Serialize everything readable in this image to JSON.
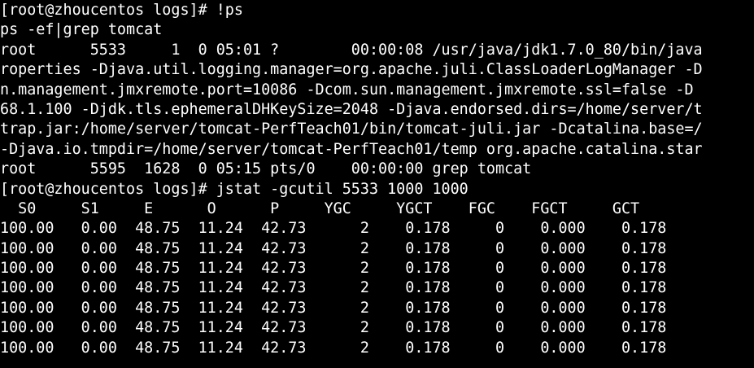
{
  "terminal": {
    "background": "#000000",
    "foreground": "#ffffff",
    "lines": [
      "[root@zhoucentos logs]# !ps",
      "ps -ef|grep tomcat",
      "root      5533     1  0 05:01 ?        00:00:08 /usr/java/jdk1.7.0_80/bin/java",
      "roperties -Djava.util.logging.manager=org.apache.juli.ClassLoaderLogManager -D",
      "n.management.jmxremote.port=10086 -Dcom.sun.management.jmxremote.ssl=false -D",
      "68.1.100 -Djdk.tls.ephemeralDHKeySize=2048 -Djava.endorsed.dirs=/home/server/t",
      "trap.jar:/home/server/tomcat-PerfTeach01/bin/tomcat-juli.jar -Dcatalina.base=/",
      "-Djava.io.tmpdir=/home/server/tomcat-PerfTeach01/temp org.apache.catalina.star",
      "root      5595  1628  0 05:15 pts/0    00:00:00 grep tomcat",
      "[root@zhoucentos logs]# jstat -gcutil 5533 1000 1000",
      "  S0     S1     E      O      P     YGC     YGCT    FGC    FGCT     GCT",
      "100.00   0.00  48.75  11.24  42.73      2    0.178     0    0.000    0.178",
      "100.00   0.00  48.75  11.24  42.73      2    0.178     0    0.000    0.178",
      "100.00   0.00  48.75  11.24  42.73      2    0.178     0    0.000    0.178",
      "100.00   0.00  48.75  11.24  42.73      2    0.178     0    0.000    0.178",
      "100.00   0.00  48.75  11.24  42.73      2    0.178     0    0.000    0.178",
      "100.00   0.00  48.75  11.24  42.73      2    0.178     0    0.000    0.178",
      "100.00   0.00  48.75  11.24  42.73      2    0.178     0    0.000    0.178"
    ]
  }
}
